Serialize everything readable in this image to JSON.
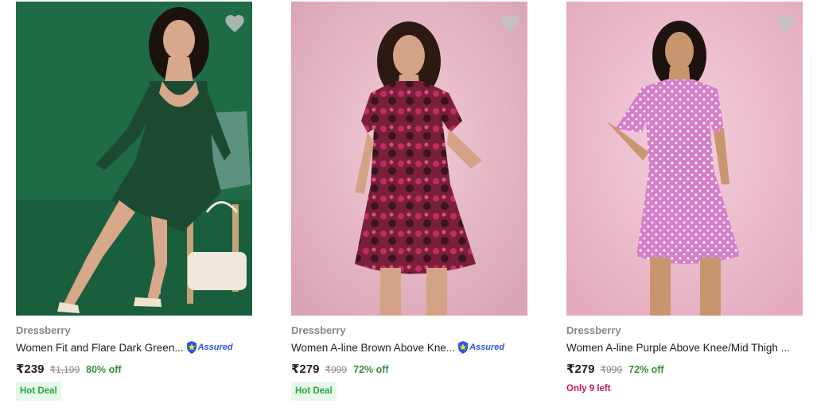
{
  "products": [
    {
      "brand": "Dressberry",
      "title": "Women Fit and Flare Dark Green...",
      "assured_label": "Assured",
      "price": "₹239",
      "mrp": "₹1,199",
      "discount": "80% off",
      "tag": "Hot Deal",
      "colors": {
        "background": "#1f6b46",
        "dress": "#1c4a31"
      }
    },
    {
      "brand": "Dressberry",
      "title": "Women A-line Brown Above Kne...",
      "assured_label": "Assured",
      "price": "₹279",
      "mrp": "₹999",
      "discount": "72% off",
      "tag": "Hot Deal",
      "colors": {
        "background": "#e7b9c6",
        "dress": "#7a1f3a"
      }
    },
    {
      "brand": "Dressberry",
      "title": "Women A-line Purple Above Knee/Mid Thigh ...",
      "price": "₹279",
      "mrp": "₹999",
      "discount": "72% off",
      "stock_note": "Only 9 left",
      "colors": {
        "background": "#eebfd0",
        "dress": "#d57ec9"
      }
    }
  ],
  "icons": {
    "wishlist": "heart-icon",
    "assured": "shield-icon"
  },
  "accent": {
    "discount": "#388e3c",
    "stock": "#c2185b",
    "assured": "#2a55e5"
  }
}
